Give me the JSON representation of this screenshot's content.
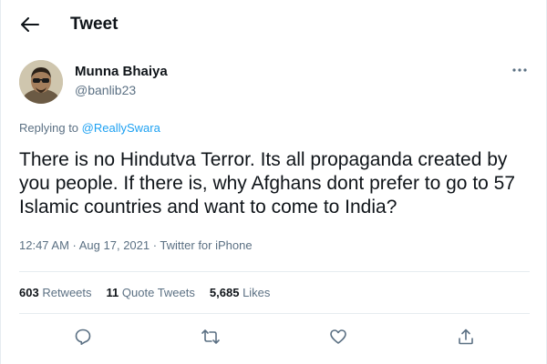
{
  "header": {
    "back_icon": "arrow-left-icon",
    "title": "Tweet"
  },
  "author": {
    "name": "Munna Bhaiya",
    "handle": "@banlib23",
    "more_icon": "more-horizontal-icon"
  },
  "reply_context": {
    "prefix": "Replying to ",
    "mention": "@ReallySwara"
  },
  "tweet": {
    "text": "There is no Hindutva Terror. Its all propaganda created by you people. If there is, why Afghans dont prefer to go to 57 Islamic countries and want to come to India?",
    "meta": "12:47 AM · Aug 17, 2021 · Twitter for iPhone"
  },
  "stats": {
    "retweets_count": "603",
    "retweets_label": "Retweets",
    "quotes_count": "11",
    "quotes_label": "Quote Tweets",
    "likes_count": "5,685",
    "likes_label": "Likes"
  },
  "actions": [
    {
      "icon": "reply-icon"
    },
    {
      "icon": "retweet-icon"
    },
    {
      "icon": "like-heart-icon"
    },
    {
      "icon": "share-icon"
    }
  ],
  "colors": {
    "accent": "#1da1f2",
    "secondary_text": "#5b7083",
    "primary_text": "#0f1419",
    "divider": "#e6ecf0"
  }
}
